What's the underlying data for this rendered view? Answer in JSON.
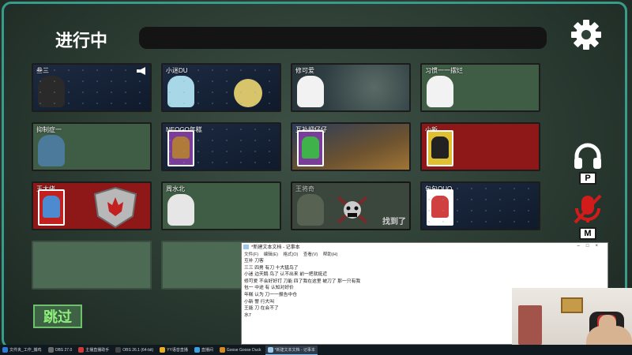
{
  "game": {
    "title": "进行中",
    "skip_label": "跳过",
    "found_label": "找到了",
    "players": [
      {
        "name": "叁三",
        "theme": "space"
      },
      {
        "name": "小迷DU",
        "theme": "space-moon"
      },
      {
        "name": "修可爱",
        "theme": "bubbles"
      },
      {
        "name": "习惯一一摆烂",
        "theme": "plain"
      },
      {
        "name": "抑制症一",
        "theme": "plain"
      },
      {
        "name": "NEOGO年糕",
        "theme": "dark"
      },
      {
        "name": "互补把仔仔",
        "theme": "desert"
      },
      {
        "name": "小新",
        "theme": "red"
      },
      {
        "name": "王大佬",
        "theme": "red-shield"
      },
      {
        "name": "周水北",
        "theme": "plain"
      },
      {
        "name": "王将奇",
        "theme": "dead"
      },
      {
        "name": "包包QUQ",
        "theme": "space-card"
      }
    ],
    "keys": {
      "headphones": "P",
      "mic": "M"
    },
    "icons": [
      "gear-icon",
      "megaphone-icon",
      "headphones-icon",
      "mic-muted-icon",
      "dead-goose-icon"
    ],
    "colors": {
      "frame": "#3a9b8a",
      "skip": "#8ef07a",
      "panel": "#3f5c45"
    }
  },
  "notepad": {
    "title": "*新建文本文档 - 记事本",
    "menu": [
      "文件(F)",
      "编辑(E)",
      "格式(O)",
      "查看(V)",
      "帮助(H)"
    ],
    "lines": [
      "互补 刀客",
      "三三 四男 有刀 十大猛鸟了",
      "小迷 边天鹅 鸟了 认不出来 前一把就挺近",
      "修可爱 不会好好打 刀能 四了我在这里 被刀了 那一只有我",
      "包一 中途 有 认知对好价",
      "年糕 认为 刀一一报告中仓",
      "小新 警 行大叫",
      "王能 刀 在会不了",
      "水7"
    ]
  },
  "taskbar": {
    "items": [
      "文件夹_工作_捕鸡",
      "OBS 27.0",
      "主播直播助手",
      "OBS 26.1 (64-bit)",
      "YY语音直播",
      "直播间",
      "Goose Goose Duck",
      "*新建文本文档 - 记事本"
    ]
  }
}
